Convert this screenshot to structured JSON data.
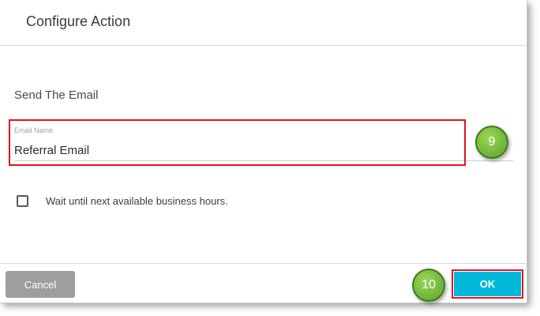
{
  "dialog": {
    "title": "Configure Action",
    "section_title": "Send The Email"
  },
  "email_field": {
    "label": "Email Name",
    "value": "Referral Email"
  },
  "wait_option": {
    "label": "Wait until next available business hours.",
    "checked": false
  },
  "footer": {
    "cancel_label": "Cancel",
    "ok_label": "OK"
  },
  "annotations": {
    "step_9": "9",
    "step_10": "10"
  },
  "colors": {
    "ok_button": "#00b8d9",
    "cancel_button": "#9e9e9e",
    "highlight": "#e0141e",
    "badge": "#73b83a"
  }
}
